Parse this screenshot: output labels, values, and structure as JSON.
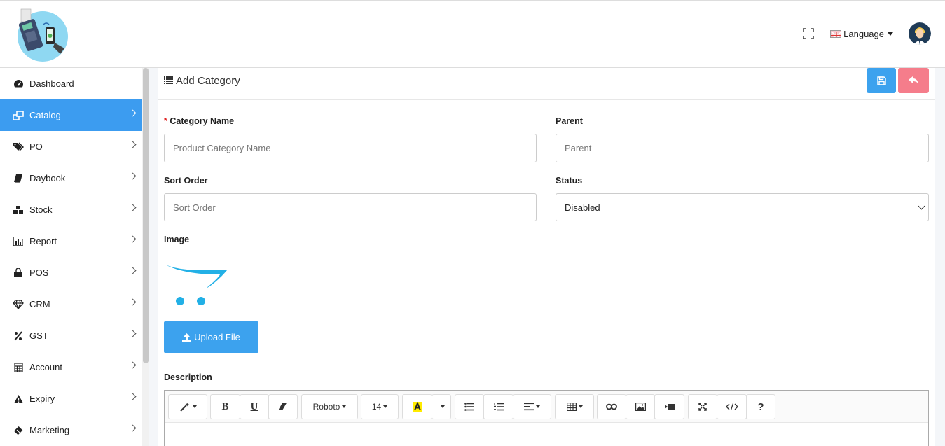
{
  "header": {
    "language_label": "Language"
  },
  "sidebar": {
    "items": [
      {
        "label": "Dashboard",
        "icon": "dashboard-icon",
        "active": false,
        "has_children": false
      },
      {
        "label": "Catalog",
        "icon": "catalog-icon",
        "active": true,
        "has_children": true
      },
      {
        "label": "PO",
        "icon": "tags-icon",
        "active": false,
        "has_children": true
      },
      {
        "label": "Daybook",
        "icon": "book-icon",
        "active": false,
        "has_children": true
      },
      {
        "label": "Stock",
        "icon": "cubes-icon",
        "active": false,
        "has_children": true
      },
      {
        "label": "Report",
        "icon": "bar-chart-icon",
        "active": false,
        "has_children": true
      },
      {
        "label": "POS",
        "icon": "shopping-bag-icon",
        "active": false,
        "has_children": true
      },
      {
        "label": "CRM",
        "icon": "diamond-icon",
        "active": false,
        "has_children": true
      },
      {
        "label": "GST",
        "icon": "percent-icon",
        "active": false,
        "has_children": true
      },
      {
        "label": "Account",
        "icon": "calculator-icon",
        "active": false,
        "has_children": true
      },
      {
        "label": "Expiry",
        "icon": "warning-icon",
        "active": false,
        "has_children": true
      },
      {
        "label": "Marketing",
        "icon": "ticket-icon",
        "active": false,
        "has_children": true
      }
    ]
  },
  "form": {
    "title": "Add Category",
    "category_name": {
      "label": "Category Name",
      "required_mark": "*",
      "placeholder": "Product Category Name",
      "value": ""
    },
    "parent": {
      "label": "Parent",
      "placeholder": "Parent",
      "value": ""
    },
    "sort_order": {
      "label": "Sort Order",
      "placeholder": "Sort Order",
      "value": ""
    },
    "status": {
      "label": "Status",
      "selected": "Disabled"
    },
    "image": {
      "label": "Image",
      "upload_label": "Upload File"
    },
    "description": {
      "label": "Description",
      "font_family": "Roboto",
      "font_size": "14"
    }
  },
  "colors": {
    "primary": "#3ca2ee",
    "danger": "#f57d8b",
    "active_nav": "#3c9cf0"
  }
}
